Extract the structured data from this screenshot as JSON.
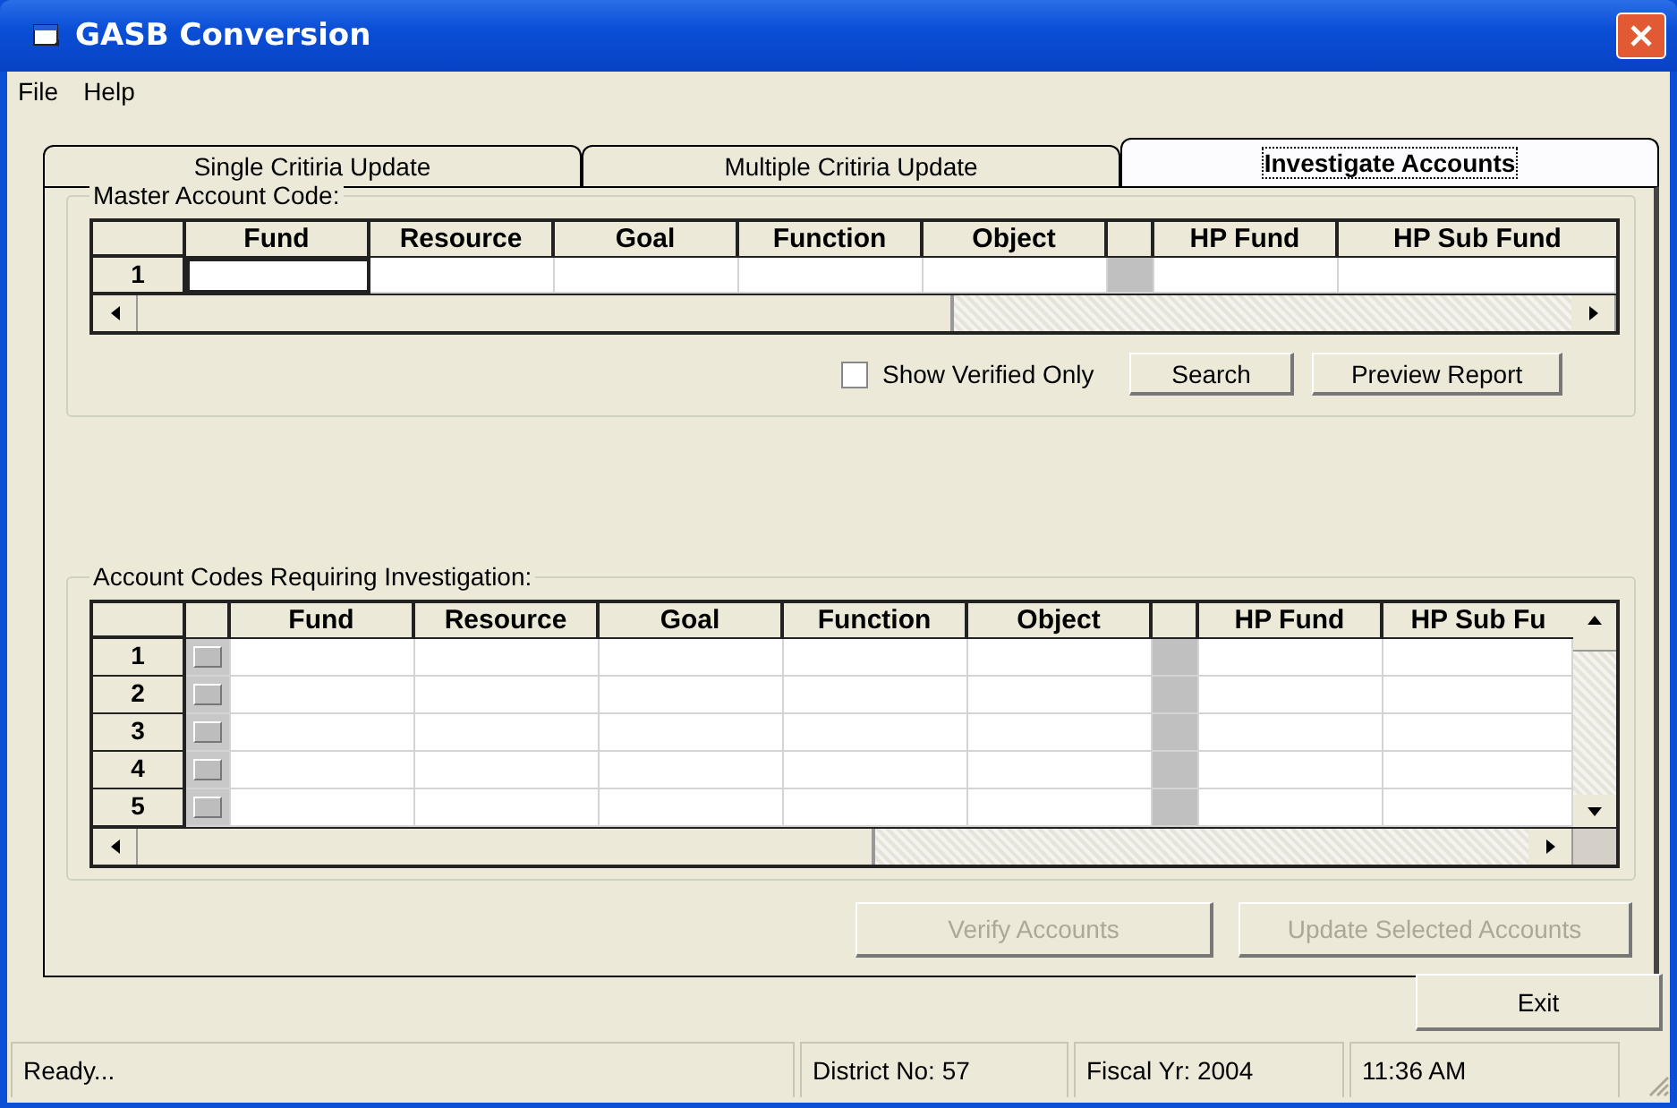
{
  "window": {
    "title": "GASB Conversion"
  },
  "menu": [
    "File",
    "Help"
  ],
  "tabs": [
    {
      "label": "Single Critiria Update",
      "selected": false
    },
    {
      "label": "Multiple Critiria Update",
      "selected": false
    },
    {
      "label": "Investigate Accounts",
      "selected": true
    }
  ],
  "master": {
    "legend": "Master Account Code:",
    "columns": [
      {
        "kind": "data",
        "label": "Fund"
      },
      {
        "kind": "data",
        "label": "Resource"
      },
      {
        "kind": "data",
        "label": "Goal"
      },
      {
        "kind": "data",
        "label": "Function"
      },
      {
        "kind": "data",
        "label": "Object"
      },
      {
        "kind": "spacer"
      },
      {
        "kind": "data",
        "label": "HP Fund"
      },
      {
        "kind": "wide",
        "label": "HP Sub Fund"
      }
    ],
    "rows": [
      {
        "number": "1"
      }
    ],
    "show_verified_only": {
      "label": "Show Verified Only",
      "checked": false
    },
    "buttons": [
      "Search",
      "Preview Report"
    ]
  },
  "investigation": {
    "legend": "Account Codes Requiring Investigation:",
    "columns": [
      {
        "kind": "check"
      },
      {
        "kind": "data",
        "label": "Fund"
      },
      {
        "kind": "data",
        "label": "Resource"
      },
      {
        "kind": "data",
        "label": "Goal"
      },
      {
        "kind": "data",
        "label": "Function"
      },
      {
        "kind": "data",
        "label": "Object"
      },
      {
        "kind": "spacer"
      },
      {
        "kind": "data",
        "label": "HP Fund"
      },
      {
        "kind": "wide",
        "label": "HP Sub Fu"
      }
    ],
    "rows": [
      {
        "number": "1",
        "checked": false
      },
      {
        "number": "2",
        "checked": false
      },
      {
        "number": "3",
        "checked": false
      },
      {
        "number": "4",
        "checked": false
      },
      {
        "number": "5",
        "checked": false
      }
    ]
  },
  "actions": [
    {
      "label": "Verify Accounts",
      "disabled": true
    },
    {
      "label": "Update Selected Accounts",
      "disabled": true
    }
  ],
  "exit_button": "Exit",
  "status_bar": [
    "Ready...",
    "District No: 57",
    "Fiscal Yr: 2004",
    "11:36 AM"
  ]
}
